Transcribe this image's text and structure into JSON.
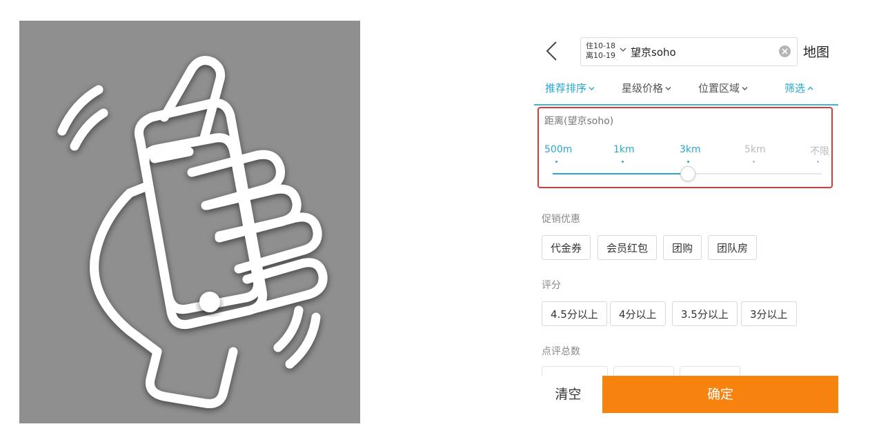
{
  "screen": {
    "header": {
      "dates": {
        "checkin": "住10-18",
        "checkout": "离10-19"
      },
      "search_value": "望京soho",
      "map_label": "地图"
    },
    "filter_tabs": [
      {
        "label": "推荐排序",
        "active": true
      },
      {
        "label": "星级价格",
        "active": false
      },
      {
        "label": "位置区域",
        "active": false
      },
      {
        "label": "筛选",
        "active": true
      }
    ],
    "distance": {
      "title": "距离(望京soho)",
      "stops": [
        "500m",
        "1km",
        "3km",
        "5km",
        "不限"
      ],
      "selected_stop": "3km"
    },
    "promotions": {
      "title": "促销优惠",
      "options": [
        "代金券",
        "会员红包",
        "团购",
        "团队房"
      ]
    },
    "rating": {
      "title": "评分",
      "options": [
        "4.5分以上",
        "4分以上",
        "3.5分以上",
        "3分以上"
      ]
    },
    "review_count": {
      "title": "点评总数"
    },
    "actions": {
      "clear_label": "清空",
      "confirm_label": "确定"
    }
  },
  "colors": {
    "accent": "#29a6cd",
    "confirm": "#f7830e",
    "highlight_border": "#d63a33"
  },
  "illustration": {
    "icon": "hand-shaking-phone-icon"
  }
}
